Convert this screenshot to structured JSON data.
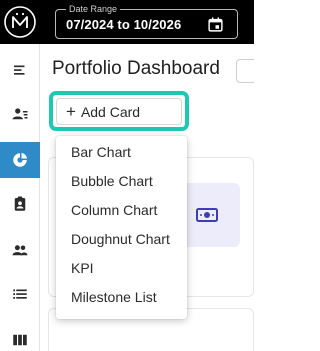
{
  "header": {
    "date_range": {
      "label": "Date Range",
      "value": "07/2024 to 10/2026"
    }
  },
  "sidebar": {
    "items": [
      {
        "icon": "menu-icon"
      },
      {
        "icon": "people-list-icon"
      },
      {
        "icon": "dashboard-icon",
        "active": true
      },
      {
        "icon": "clipboard-user-icon"
      },
      {
        "icon": "group-icon"
      },
      {
        "icon": "list-icon"
      },
      {
        "icon": "columns-icon"
      }
    ]
  },
  "main": {
    "page_title": "Portfolio Dashboard",
    "add_card": {
      "plus": "+",
      "label": "Add Card"
    },
    "menu": {
      "items": [
        {
          "label": "Bar Chart"
        },
        {
          "label": "Bubble Chart"
        },
        {
          "label": "Column Chart"
        },
        {
          "label": "Doughnut Chart"
        },
        {
          "label": "KPI"
        },
        {
          "label": "Milestone List"
        }
      ]
    }
  },
  "colors": {
    "header_bg": "#000000",
    "sidebar_active": "#2e8bc7",
    "highlight": "#1ec8b5",
    "card_tile_bg": "#ececfa",
    "card_icon": "#3d3fb0"
  }
}
